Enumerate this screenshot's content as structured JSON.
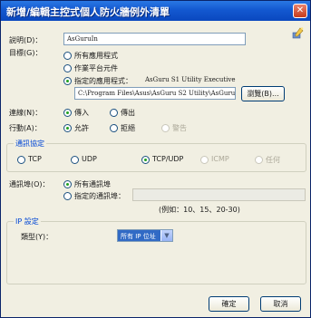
{
  "window": {
    "title": "新增/編輯主控式個人防火牆例外清單",
    "close_label": "✕"
  },
  "description": {
    "label": "説明(D)：",
    "value": "AsGuruIn"
  },
  "target": {
    "label": "目標(G)：",
    "all_programs": "所有應用程式",
    "os_component": "作業平台元件",
    "specific_program": "指定的應用程式：",
    "specific_program_name": "AsGuru S1 Utility Executive",
    "path_value": "C:\\Program Files\\Asus\\AsGuru S2 Utility\\AsGuruS2U",
    "browse_button": "瀏覽(B)..."
  },
  "direction": {
    "label": "連線(N)：",
    "incoming": "傳入",
    "outgoing": "傳出"
  },
  "action": {
    "label": "行動(A)：",
    "allow": "允許",
    "deny": "拒絕",
    "warn": "警告"
  },
  "protocol": {
    "group_title": "通訊協定",
    "tcp": "TCP",
    "udp": "UDP",
    "tcpudp": "TCP/UDP",
    "icmp": "ICMP",
    "any": "任何"
  },
  "ports": {
    "label": "通訊埠(O)：",
    "all_ports": "所有通訊埠",
    "specific_ports": "指定的通訊埠：",
    "example": "(例如：10、15、20-30)"
  },
  "ip": {
    "group_title": "IP 設定",
    "type_label": "類型(Y)：",
    "type_value": "所有 IP 位址"
  },
  "buttons": {
    "ok": "確定",
    "cancel": "取消"
  }
}
